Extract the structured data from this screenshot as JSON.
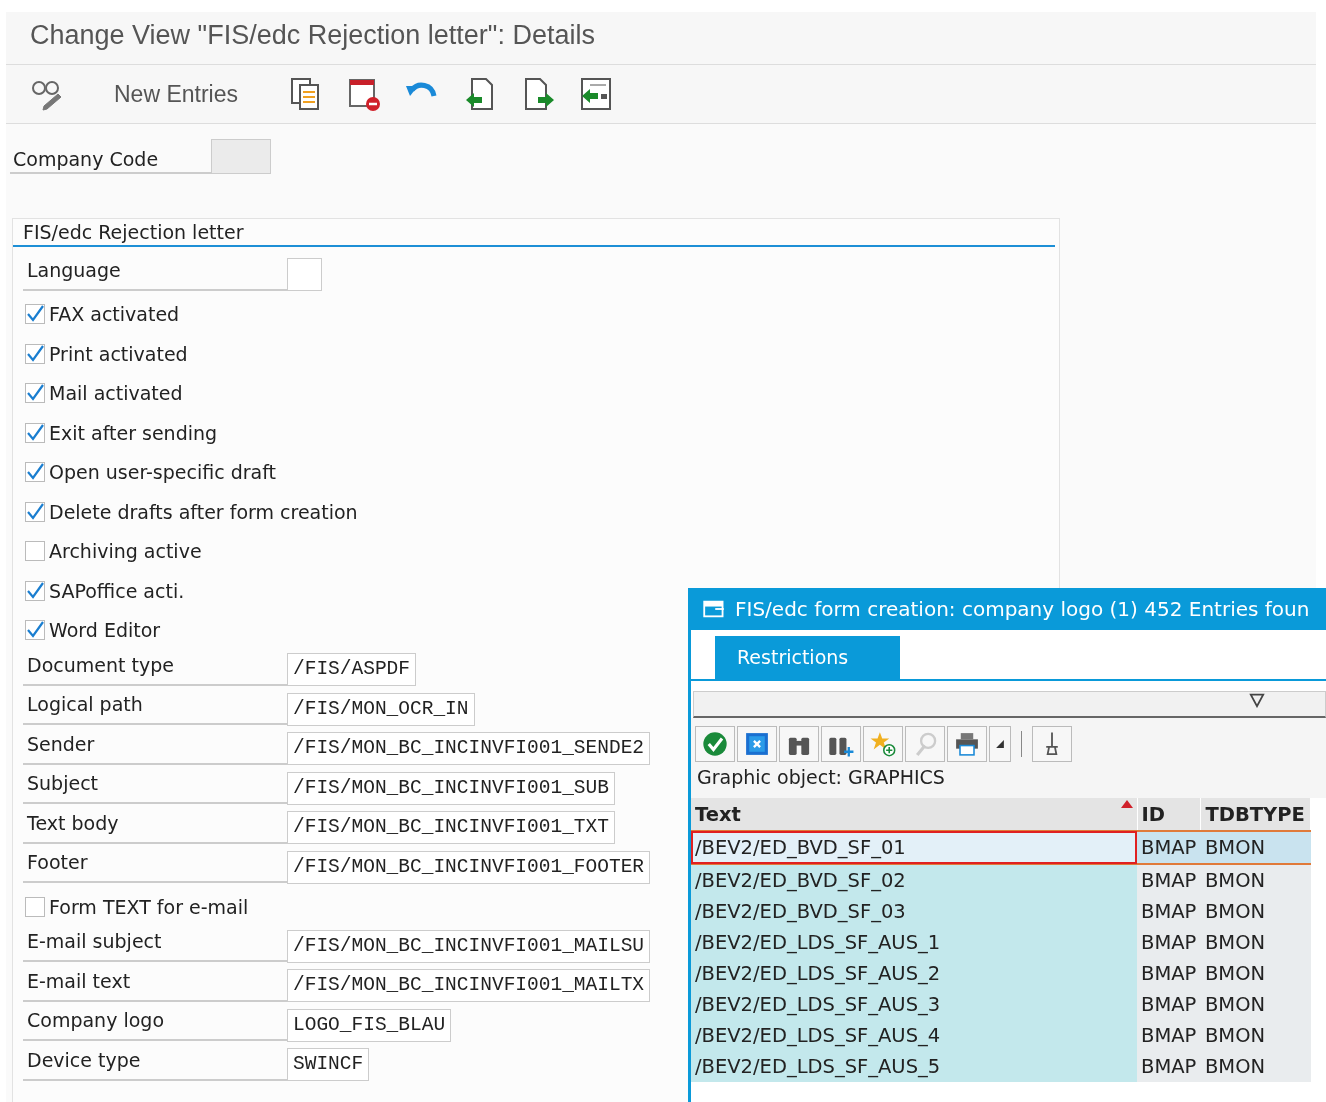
{
  "window": {
    "title": "Change View \"FIS/edc Rejection letter\": Details"
  },
  "toolbar": {
    "new_entries": "New Entries"
  },
  "header_field": {
    "label": "Company Code"
  },
  "group": {
    "title": "FIS/edc Rejection letter",
    "rows": [
      {
        "kind": "field",
        "label": "Language"
      },
      {
        "kind": "checkbox",
        "label": "FAX activated",
        "checked": true
      },
      {
        "kind": "checkbox",
        "label": "Print activated",
        "checked": true
      },
      {
        "kind": "checkbox",
        "label": "Mail activated",
        "checked": true
      },
      {
        "kind": "checkbox",
        "label": "Exit after sending",
        "checked": true
      },
      {
        "kind": "checkbox",
        "label": "Open user-specific draft",
        "checked": true
      },
      {
        "kind": "checkbox",
        "label": "Delete drafts after form creation",
        "checked": true
      },
      {
        "kind": "checkbox",
        "label": "Archiving active",
        "checked": false
      },
      {
        "kind": "checkbox",
        "label": "SAPoffice acti.",
        "checked": true
      },
      {
        "kind": "checkbox",
        "label": "Word Editor",
        "checked": true
      },
      {
        "kind": "field",
        "label": "Document type",
        "value": "/FIS/ASPDF"
      },
      {
        "kind": "field",
        "label": "Logical path",
        "value": "/FIS/MON_OCR_IN"
      },
      {
        "kind": "field",
        "label": "Sender",
        "value": "/FIS/MON_BC_INCINVFI001_SENDE2"
      },
      {
        "kind": "field",
        "label": "Subject",
        "value": "/FIS/MON_BC_INCINVFI001_SUB"
      },
      {
        "kind": "field",
        "label": "Text body",
        "value": "/FIS/MON_BC_INCINVFI001_TXT"
      },
      {
        "kind": "field",
        "label": "Footer",
        "value": "/FIS/MON_BC_INCINVFI001_FOOTER"
      },
      {
        "kind": "checkbox",
        "label": "Form TEXT for e-mail",
        "checked": false
      },
      {
        "kind": "field",
        "label": "E-mail subject",
        "value": "/FIS/MON_BC_INCINVFI001_MAILSU"
      },
      {
        "kind": "field",
        "label": "E-mail text",
        "value": "/FIS/MON_BC_INCINVFI001_MAILTX"
      },
      {
        "kind": "field",
        "label": "Company logo",
        "value": "LOGO_FIS_BLAU"
      },
      {
        "kind": "field",
        "label": "Device type",
        "value": "SWINCF"
      }
    ]
  },
  "popup": {
    "title": "FIS/edc form creation: company logo (1)  452 Entries foun",
    "tabs": [
      {
        "label": "Restrictions",
        "selected": true
      }
    ],
    "info": "Graphic object: GRAPHICS",
    "table": {
      "columns": [
        "Text",
        "ID",
        "TDBTYPE"
      ],
      "rows": [
        {
          "cells": [
            "/BEV2/ED_BVD_SF_01",
            "BMAP",
            "BMON"
          ],
          "selected": true
        },
        {
          "cells": [
            "/BEV2/ED_BVD_SF_02",
            "BMAP",
            "BMON"
          ],
          "selected": false
        },
        {
          "cells": [
            "/BEV2/ED_BVD_SF_03",
            "BMAP",
            "BMON"
          ],
          "selected": false
        },
        {
          "cells": [
            "/BEV2/ED_LDS_SF_AUS_1",
            "BMAP",
            "BMON"
          ],
          "selected": false
        },
        {
          "cells": [
            "/BEV2/ED_LDS_SF_AUS_2",
            "BMAP",
            "BMON"
          ],
          "selected": false
        },
        {
          "cells": [
            "/BEV2/ED_LDS_SF_AUS_3",
            "BMAP",
            "BMON"
          ],
          "selected": false
        },
        {
          "cells": [
            "/BEV2/ED_LDS_SF_AUS_4",
            "BMAP",
            "BMON"
          ],
          "selected": false
        },
        {
          "cells": [
            "/BEV2/ED_LDS_SF_AUS_5",
            "BMAP",
            "BMON"
          ],
          "selected": false
        }
      ]
    }
  }
}
